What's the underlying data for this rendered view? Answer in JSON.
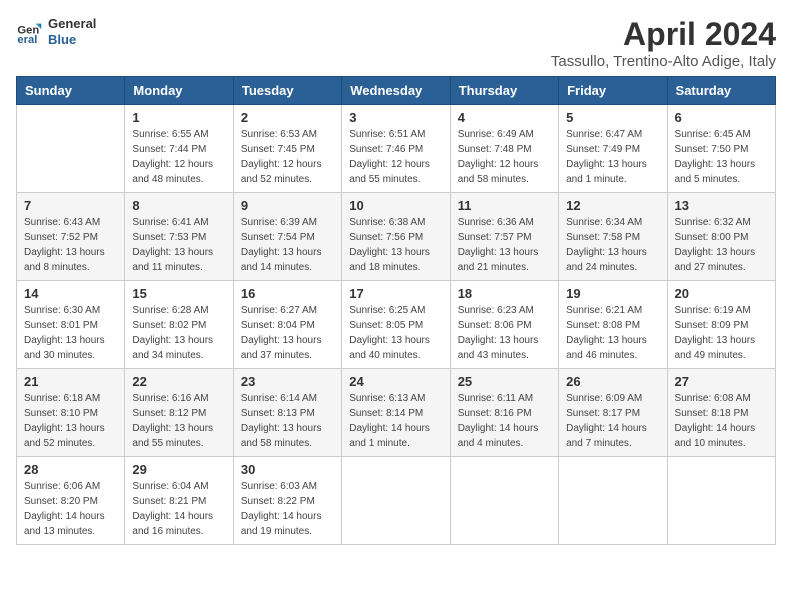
{
  "header": {
    "logo_line1": "General",
    "logo_line2": "Blue",
    "month_title": "April 2024",
    "location": "Tassullo, Trentino-Alto Adige, Italy"
  },
  "days_of_week": [
    "Sunday",
    "Monday",
    "Tuesday",
    "Wednesday",
    "Thursday",
    "Friday",
    "Saturday"
  ],
  "weeks": [
    [
      {
        "day": "",
        "info": ""
      },
      {
        "day": "1",
        "info": "Sunrise: 6:55 AM\nSunset: 7:44 PM\nDaylight: 12 hours\nand 48 minutes."
      },
      {
        "day": "2",
        "info": "Sunrise: 6:53 AM\nSunset: 7:45 PM\nDaylight: 12 hours\nand 52 minutes."
      },
      {
        "day": "3",
        "info": "Sunrise: 6:51 AM\nSunset: 7:46 PM\nDaylight: 12 hours\nand 55 minutes."
      },
      {
        "day": "4",
        "info": "Sunrise: 6:49 AM\nSunset: 7:48 PM\nDaylight: 12 hours\nand 58 minutes."
      },
      {
        "day": "5",
        "info": "Sunrise: 6:47 AM\nSunset: 7:49 PM\nDaylight: 13 hours\nand 1 minute."
      },
      {
        "day": "6",
        "info": "Sunrise: 6:45 AM\nSunset: 7:50 PM\nDaylight: 13 hours\nand 5 minutes."
      }
    ],
    [
      {
        "day": "7",
        "info": "Sunrise: 6:43 AM\nSunset: 7:52 PM\nDaylight: 13 hours\nand 8 minutes."
      },
      {
        "day": "8",
        "info": "Sunrise: 6:41 AM\nSunset: 7:53 PM\nDaylight: 13 hours\nand 11 minutes."
      },
      {
        "day": "9",
        "info": "Sunrise: 6:39 AM\nSunset: 7:54 PM\nDaylight: 13 hours\nand 14 minutes."
      },
      {
        "day": "10",
        "info": "Sunrise: 6:38 AM\nSunset: 7:56 PM\nDaylight: 13 hours\nand 18 minutes."
      },
      {
        "day": "11",
        "info": "Sunrise: 6:36 AM\nSunset: 7:57 PM\nDaylight: 13 hours\nand 21 minutes."
      },
      {
        "day": "12",
        "info": "Sunrise: 6:34 AM\nSunset: 7:58 PM\nDaylight: 13 hours\nand 24 minutes."
      },
      {
        "day": "13",
        "info": "Sunrise: 6:32 AM\nSunset: 8:00 PM\nDaylight: 13 hours\nand 27 minutes."
      }
    ],
    [
      {
        "day": "14",
        "info": "Sunrise: 6:30 AM\nSunset: 8:01 PM\nDaylight: 13 hours\nand 30 minutes."
      },
      {
        "day": "15",
        "info": "Sunrise: 6:28 AM\nSunset: 8:02 PM\nDaylight: 13 hours\nand 34 minutes."
      },
      {
        "day": "16",
        "info": "Sunrise: 6:27 AM\nSunset: 8:04 PM\nDaylight: 13 hours\nand 37 minutes."
      },
      {
        "day": "17",
        "info": "Sunrise: 6:25 AM\nSunset: 8:05 PM\nDaylight: 13 hours\nand 40 minutes."
      },
      {
        "day": "18",
        "info": "Sunrise: 6:23 AM\nSunset: 8:06 PM\nDaylight: 13 hours\nand 43 minutes."
      },
      {
        "day": "19",
        "info": "Sunrise: 6:21 AM\nSunset: 8:08 PM\nDaylight: 13 hours\nand 46 minutes."
      },
      {
        "day": "20",
        "info": "Sunrise: 6:19 AM\nSunset: 8:09 PM\nDaylight: 13 hours\nand 49 minutes."
      }
    ],
    [
      {
        "day": "21",
        "info": "Sunrise: 6:18 AM\nSunset: 8:10 PM\nDaylight: 13 hours\nand 52 minutes."
      },
      {
        "day": "22",
        "info": "Sunrise: 6:16 AM\nSunset: 8:12 PM\nDaylight: 13 hours\nand 55 minutes."
      },
      {
        "day": "23",
        "info": "Sunrise: 6:14 AM\nSunset: 8:13 PM\nDaylight: 13 hours\nand 58 minutes."
      },
      {
        "day": "24",
        "info": "Sunrise: 6:13 AM\nSunset: 8:14 PM\nDaylight: 14 hours\nand 1 minute."
      },
      {
        "day": "25",
        "info": "Sunrise: 6:11 AM\nSunset: 8:16 PM\nDaylight: 14 hours\nand 4 minutes."
      },
      {
        "day": "26",
        "info": "Sunrise: 6:09 AM\nSunset: 8:17 PM\nDaylight: 14 hours\nand 7 minutes."
      },
      {
        "day": "27",
        "info": "Sunrise: 6:08 AM\nSunset: 8:18 PM\nDaylight: 14 hours\nand 10 minutes."
      }
    ],
    [
      {
        "day": "28",
        "info": "Sunrise: 6:06 AM\nSunset: 8:20 PM\nDaylight: 14 hours\nand 13 minutes."
      },
      {
        "day": "29",
        "info": "Sunrise: 6:04 AM\nSunset: 8:21 PM\nDaylight: 14 hours\nand 16 minutes."
      },
      {
        "day": "30",
        "info": "Sunrise: 6:03 AM\nSunset: 8:22 PM\nDaylight: 14 hours\nand 19 minutes."
      },
      {
        "day": "",
        "info": ""
      },
      {
        "day": "",
        "info": ""
      },
      {
        "day": "",
        "info": ""
      },
      {
        "day": "",
        "info": ""
      }
    ]
  ]
}
